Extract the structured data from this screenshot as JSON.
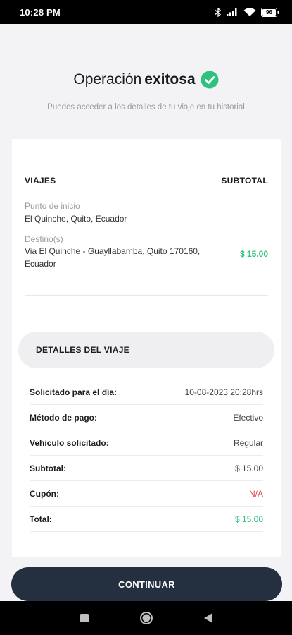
{
  "status_bar": {
    "time": "10:28 PM",
    "battery": "96",
    "icons": [
      "bluetooth-icon",
      "signal-icon",
      "wifi-icon",
      "battery-icon"
    ]
  },
  "header": {
    "title_prefix": "Operación",
    "title_strong": "exitosa",
    "subtitle": "Puedes acceder a los detalles de tu viaje en tu historial"
  },
  "trip": {
    "col_trips": "VIAJES",
    "col_subtotal": "SUBTOTAL",
    "start_label": "Punto de inicio",
    "start_value": "El Quinche, Quito, Ecuador",
    "dest_label": "Destino(s)",
    "dest_value": "Via El Quinche - Guayllabamba, Quito 170160, Ecuador",
    "price": "$ 15.00"
  },
  "details": {
    "header": "DETALLES DEL VIAJE",
    "rows": [
      {
        "label": "Solicitado para el día:",
        "value": "10-08-2023 20:28hrs"
      },
      {
        "label": "Método de pago:",
        "value": "Efectivo"
      },
      {
        "label": "Vehiculo solicitado:",
        "value": "Regular"
      },
      {
        "label": "Subtotal:",
        "value": "$ 15.00"
      },
      {
        "label": "Cupón:",
        "value": "N/A"
      },
      {
        "label": "Total:",
        "value": "$ 15.00"
      }
    ]
  },
  "button": {
    "continue_label": "CONTINUAR"
  },
  "colors": {
    "accent_green": "#2ec27e",
    "danger_red": "#e5484d",
    "button_dark": "#243040"
  }
}
